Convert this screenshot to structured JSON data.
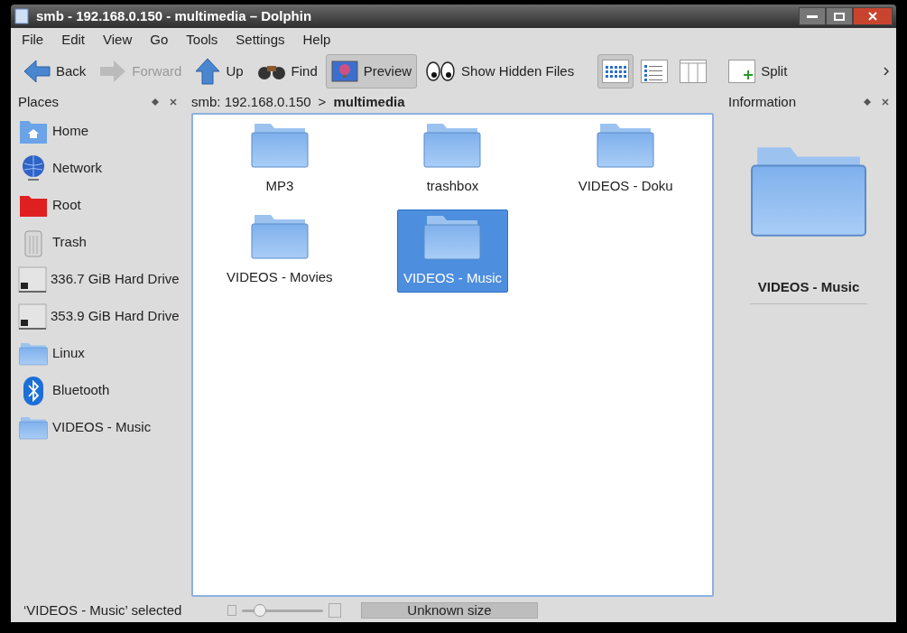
{
  "window": {
    "title": "smb - 192.168.0.150 - multimedia – Dolphin"
  },
  "menu": [
    "File",
    "Edit",
    "View",
    "Go",
    "Tools",
    "Settings",
    "Help"
  ],
  "toolbar": [
    {
      "kind": "back",
      "label": "Back",
      "disabled": false,
      "pressed": false
    },
    {
      "kind": "forward",
      "label": "Forward",
      "disabled": true,
      "pressed": false
    },
    {
      "kind": "up",
      "label": "Up",
      "disabled": false,
      "pressed": false
    },
    {
      "kind": "find",
      "label": "Find",
      "disabled": false,
      "pressed": false
    },
    {
      "kind": "preview",
      "label": "Preview",
      "disabled": false,
      "pressed": true
    },
    {
      "kind": "hidden",
      "label": "Show Hidden Files",
      "disabled": false,
      "pressed": false
    }
  ],
  "view_modes": [
    {
      "kind": "icons",
      "selected": true
    },
    {
      "kind": "details",
      "selected": false
    },
    {
      "kind": "columns",
      "selected": false
    }
  ],
  "split": {
    "label": "Split"
  },
  "places": {
    "title": "Places",
    "items": [
      {
        "kind": "home",
        "label": "Home"
      },
      {
        "kind": "network",
        "label": "Network"
      },
      {
        "kind": "root",
        "label": "Root"
      },
      {
        "kind": "trash",
        "label": "Trash"
      },
      {
        "kind": "drive",
        "label": "336.7 GiB Hard Drive"
      },
      {
        "kind": "drive",
        "label": "353.9 GiB Hard Drive"
      },
      {
        "kind": "folder",
        "label": "Linux"
      },
      {
        "kind": "bluetooth",
        "label": "Bluetooth"
      },
      {
        "kind": "folder",
        "label": "VIDEOS - Music"
      }
    ]
  },
  "breadcrumb": {
    "path": "smb: 192.168.0.150",
    "separator": ">",
    "current": "multimedia"
  },
  "files": [
    {
      "name": "MP3",
      "selected": false
    },
    {
      "name": "trashbox",
      "selected": false
    },
    {
      "name": "VIDEOS - Doku",
      "selected": false
    },
    {
      "name": "VIDEOS - Movies",
      "selected": false
    },
    {
      "name": "VIDEOS - Music",
      "selected": true
    }
  ],
  "information": {
    "title": "Information",
    "name": "VIDEOS - Music"
  },
  "status_bar": {
    "text": "‘VIDEOS - Music’ selected",
    "zoom": {
      "level": 0.22
    },
    "space": "Unknown size"
  }
}
